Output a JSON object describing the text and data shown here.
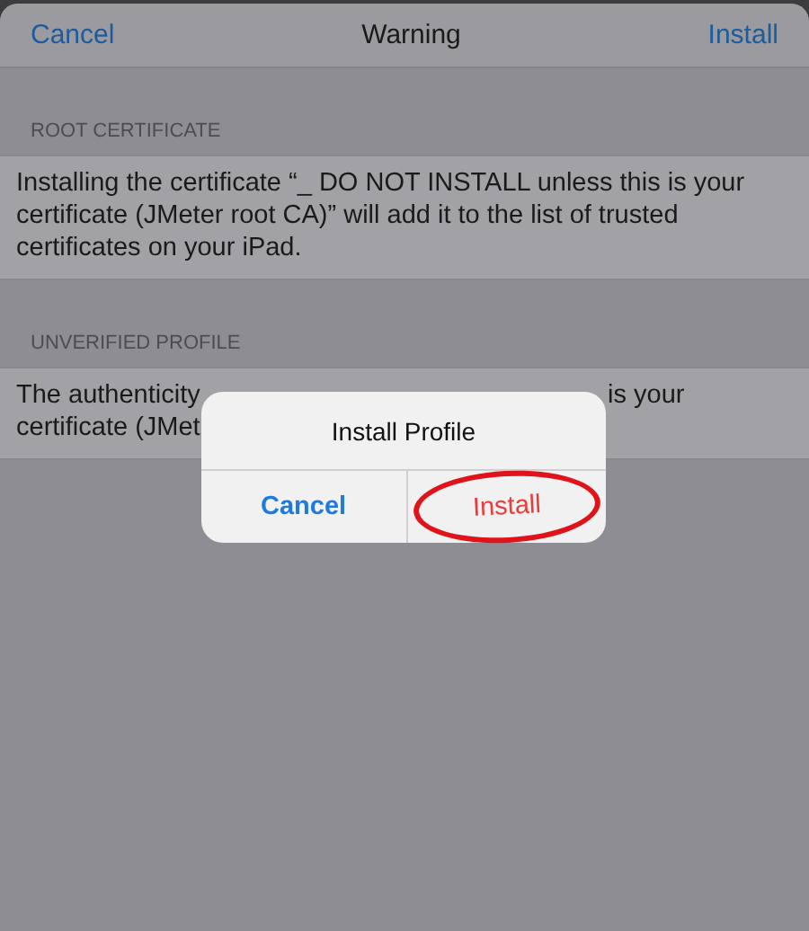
{
  "nav_bar": {
    "cancel": "Cancel",
    "title": "Warning",
    "install": "Install"
  },
  "sections": [
    {
      "header": "ROOT CERTIFICATE",
      "text": "Installing the certificate “_ DO NOT INSTALL unless this is your certificate (JMeter root CA)” will add it to the list of trusted certificates on your iPad."
    },
    {
      "header": "UNVERIFIED PROFILE",
      "lines": [
        [
          "The authenticity",
          "is your"
        ],
        [
          "certificate (JMet"
        ]
      ]
    }
  ],
  "alert": {
    "title": "Install Profile",
    "buttons": [
      {
        "label": "Cancel",
        "kind": "cancel",
        "circled": false
      },
      {
        "label": "Install",
        "kind": "destructive",
        "circled": true
      }
    ]
  }
}
